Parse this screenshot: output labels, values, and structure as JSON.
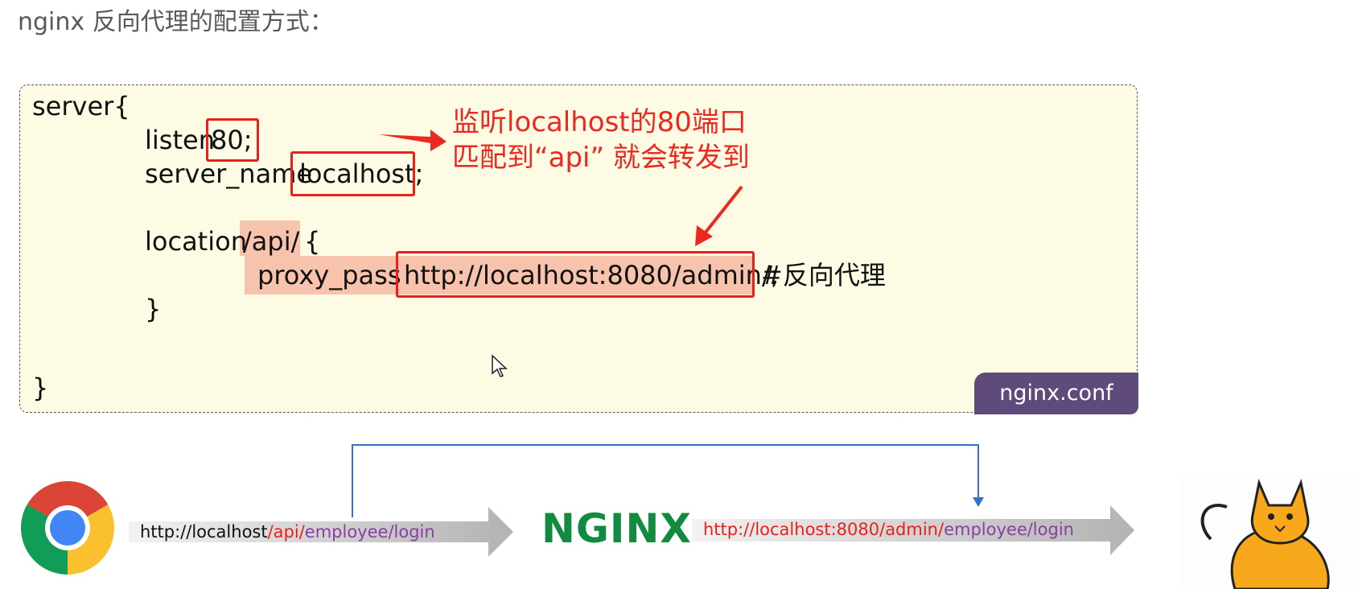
{
  "heading": "nginx 反向代理的配置方式：",
  "code": {
    "server_open": "server{",
    "listen_kw": "listen",
    "listen_val": "80;",
    "server_name_kw": "server_name",
    "server_name_val": "localhost;",
    "location_kw": "location",
    "location_path": "/api/",
    "location_brace": "{",
    "proxy_pass_kw": "proxy_pass",
    "proxy_pass_url": "http://localhost:8080/admin/;",
    "comment": "#反向代理",
    "inner_close": "}",
    "outer_close": "}"
  },
  "annotations": {
    "line1": "监听localhost的80端口",
    "line2": "匹配到“api” 就会转发到"
  },
  "file_tab": "nginx.conf",
  "flow": {
    "request_url": {
      "part1": "http://localhost",
      "part2": "/api/",
      "part3": "employee/login"
    },
    "proxy_label": "NGINX",
    "forward_url": {
      "part1": "http://localhost:8080/admin/",
      "part2": "employee/login"
    }
  },
  "colors": {
    "highlight": "#f8c3ad",
    "box_red": "#e8211c",
    "tab_purple": "#5f4b7b",
    "nginx_green": "#128a3f",
    "connector_blue": "#2e74c0"
  },
  "icons": [
    "chrome-logo",
    "nginx-logo",
    "tomcat-logo",
    "cursor-icon"
  ]
}
